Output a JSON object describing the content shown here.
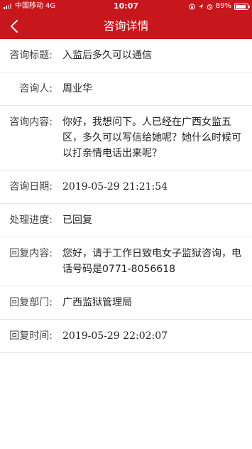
{
  "status_bar": {
    "carrier": "中国移动",
    "network": "4G",
    "time": "10:07",
    "battery": "89%"
  },
  "header": {
    "title": "咨询详情",
    "back_icon": "chevron-left-icon"
  },
  "detail": {
    "rows": [
      {
        "label": "咨询标题:",
        "value": "入监后多久可以通信"
      },
      {
        "label": "咨询人:",
        "value": "周业华"
      },
      {
        "label": "咨询内容:",
        "value": "你好，我想问下。人已经在广西女监五区，多久可以写信给她呢？她什么时候可以打亲情电话出来呢？"
      },
      {
        "label": "咨询日期:",
        "value": "2019-05-29 21:21:54"
      },
      {
        "label": "处理进度:",
        "value": "已回复"
      },
      {
        "label": "回复内容:",
        "value": "您好，请于工作日致电女子监狱咨询，电话号码是0771-8056618"
      },
      {
        "label": "回复部门:",
        "value": "广西监狱管理局"
      },
      {
        "label": "回复时间:",
        "value": "2019-05-29 22:02:07"
      }
    ]
  },
  "colors": {
    "brand_red": "#c8161d"
  }
}
